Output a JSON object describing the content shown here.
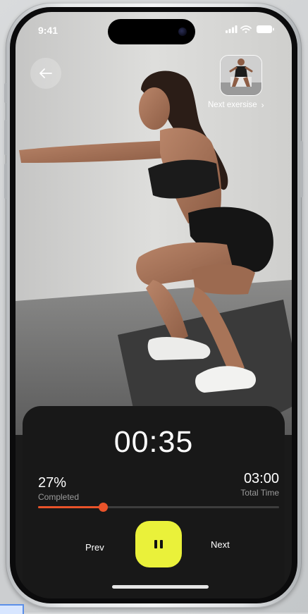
{
  "status_bar": {
    "time": "9:41",
    "icons": [
      "signal-icon",
      "wifi-icon",
      "battery-icon"
    ]
  },
  "header": {
    "back_icon": "arrow-left-icon",
    "next_exercise_label": "Next exersise",
    "next_exercise_chevron": "›"
  },
  "workout": {
    "timer": "00:35",
    "completed_value": "27%",
    "completed_fraction": 0.27,
    "completed_label": "Completed",
    "total_time_value": "03:00",
    "total_time_label": "Total Time"
  },
  "controls": {
    "prev_label": "Prev",
    "next_label": "Next",
    "pause_icon": "pause-icon"
  },
  "colors": {
    "accent_progress": "#e9532a",
    "pause_button": "#eaf13a",
    "panel_bg": "#181818"
  }
}
